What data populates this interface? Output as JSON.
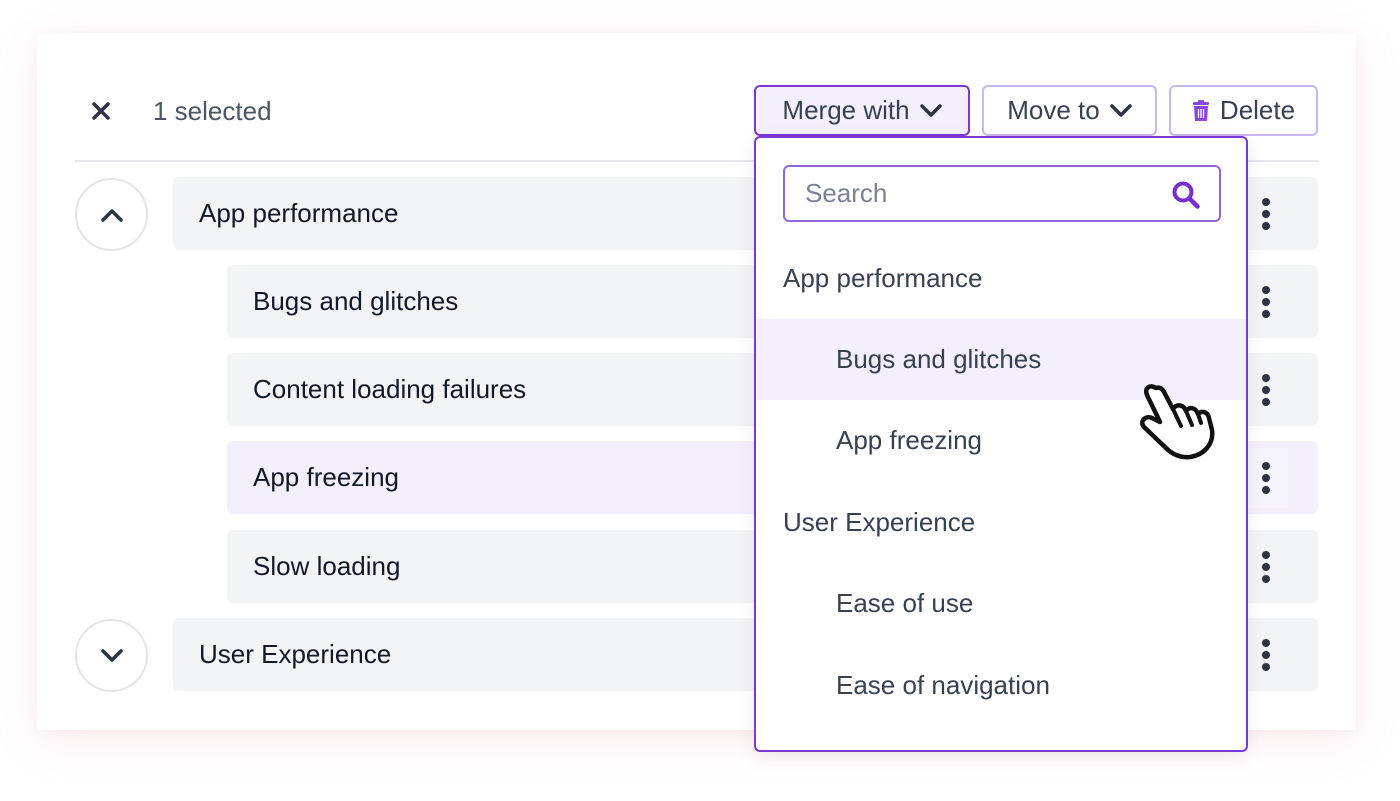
{
  "toolbar": {
    "selected_label": "1 selected",
    "merge_label": "Merge with",
    "move_label": "Move to",
    "delete_label": "Delete"
  },
  "tree": {
    "rows": [
      {
        "label": "App performance",
        "level": "parent",
        "expanded": true
      },
      {
        "label": "Bugs and glitches",
        "level": "child"
      },
      {
        "label": "Content loading failures",
        "level": "child"
      },
      {
        "label": "App freezing",
        "level": "child",
        "selected": true
      },
      {
        "label": "Slow loading",
        "level": "child"
      },
      {
        "label": "User Experience",
        "level": "parent",
        "expanded": false
      }
    ]
  },
  "merge_dropdown": {
    "search_placeholder": "Search",
    "items": [
      {
        "label": "App performance",
        "type": "group"
      },
      {
        "label": "Bugs and glitches",
        "type": "sub",
        "hovered": true
      },
      {
        "label": "App freezing",
        "type": "sub"
      },
      {
        "label": "User Experience",
        "type": "group"
      },
      {
        "label": "Ease of use",
        "type": "sub"
      },
      {
        "label": "Ease of navigation",
        "type": "sub"
      }
    ]
  },
  "colors": {
    "accent": "#7a38d6",
    "accent_light": "#f3effd",
    "row_bg": "#f3f4f6",
    "text": "#374151"
  },
  "icons": {
    "close": "close-icon",
    "chevron": "chevron-down-icon",
    "trash": "trash-icon",
    "search": "search-icon",
    "kebab": "kebab-menu-icon",
    "collapse": "chevron-up-icon",
    "cursor": "hand-pointer-icon"
  }
}
